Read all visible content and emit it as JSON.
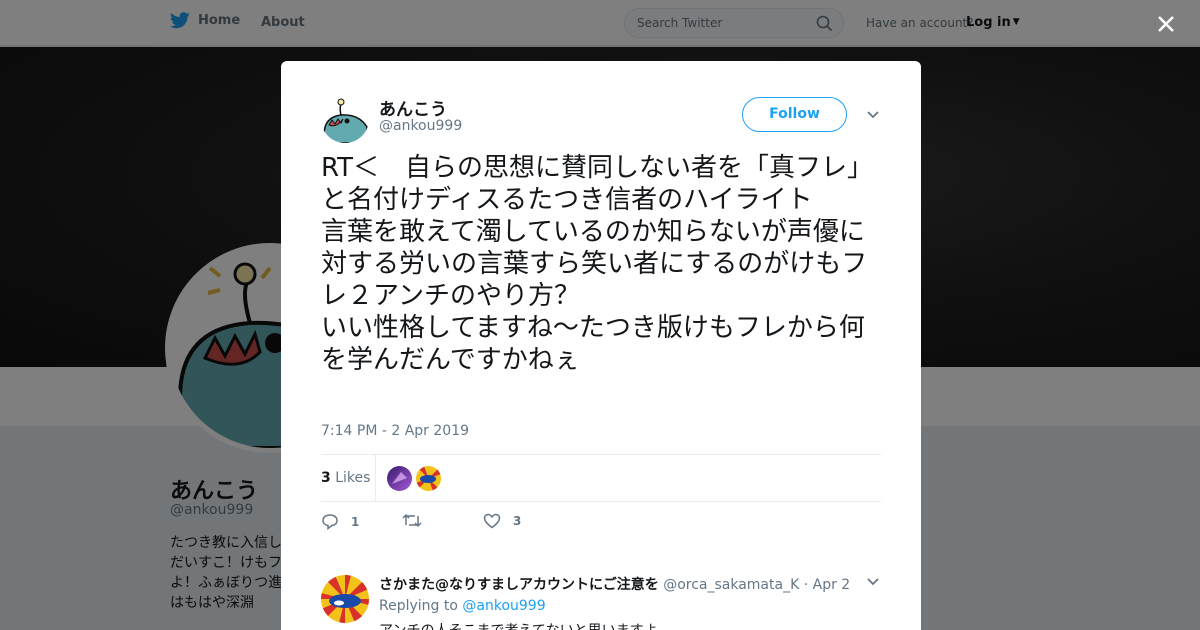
{
  "nav": {
    "home_label": "Home",
    "about_label": "About",
    "search_placeholder": "Search Twitter",
    "have_account": "Have an account?",
    "login_label": "Log in"
  },
  "profile": {
    "name": "あんこう",
    "handle": "@ankou999",
    "bio": "たつき教に入信しだいすこ！けもフよ！ふぁぼりつ進はもはや深淵"
  },
  "tweet": {
    "author_name": "あんこう",
    "author_handle": "@ankou999",
    "follow_label": "Follow",
    "text": "RT＜　自らの思想に賛同しない者を「真フレ」と名付けディスるたつき信者のハイライト\n言葉を敢えて濁しているのか知らないが声優に対する労いの言葉すら笑い者にするのがけもフレ２アンチのやり方？\nいい性格してますね～たつき版けもフレから何を学んだんですかねぇ",
    "timestamp": "7:14 PM - 2 Apr 2019",
    "likes_count": "3",
    "likes_label": "Likes",
    "reply_count": "1",
    "retweet_count": "",
    "like_count": "3"
  },
  "reply": {
    "name": "さかまた@なりすましアカウントにご注意を",
    "handle": "@orca_sakamata_K",
    "sep": "·",
    "date": "Apr 2",
    "replying_label": "Replying to",
    "replying_handle": "@ankou999",
    "body": "アンチの人そこまで考えてないと思いますよ"
  },
  "colors": {
    "accent": "#1da1f2",
    "muted": "#657786",
    "overlay": "rgba(0,0,0,0.5)"
  },
  "icons": [
    "twitter-bird-icon",
    "search-icon",
    "caret-down-icon",
    "close-icon",
    "reply-icon",
    "retweet-icon",
    "heart-icon",
    "chevron-down-icon"
  ]
}
